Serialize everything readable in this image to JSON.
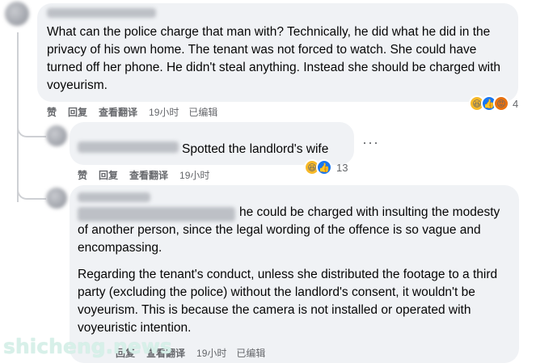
{
  "comments": [
    {
      "body": "What can the police charge that man with? Technically, he did what he did in the privacy of his own home. The tenant was not forced to watch. She could have turned off her phone. He didn't steal anything. Instead she should be charged with voyeurism.",
      "like_label": "赞",
      "reply_label": "回复",
      "translate_label": "查看翻译",
      "time": "19小时",
      "edited_label": "已编辑",
      "reaction_count": "4",
      "reaction_icons": [
        "haha-icon",
        "like-icon",
        "angry-icon"
      ]
    },
    {
      "body": "Spotted the landlord's wife",
      "like_label": "赞",
      "reply_label": "回复",
      "translate_label": "查看翻译",
      "time": "19小时",
      "reaction_count": "13",
      "reaction_icons": [
        "haha-icon",
        "like-icon"
      ]
    },
    {
      "body_p1": "he could be charged with insulting the modesty of another person, since the legal wording of the offence is so vague and encompassing.",
      "body_p2": "Regarding the tenant's conduct, unless she distributed the footage to a third party (excluding the police) without the landlord's consent, it wouldn't be voyeurism. This is because the camera is not installed or operated with voyeuristic intention.",
      "reply_label": "回复",
      "translate_label": "查看翻译",
      "time": "19小时",
      "edited_label": "已编辑"
    }
  ],
  "more_menu": "···",
  "watermark": "shicheng.news",
  "colors": {
    "bubble": "#f0f2f5",
    "meta_text": "#65676b",
    "like_blue": "#1877f2",
    "haha_yellow": "#f7b928",
    "angry_orange": "#e9710f"
  }
}
